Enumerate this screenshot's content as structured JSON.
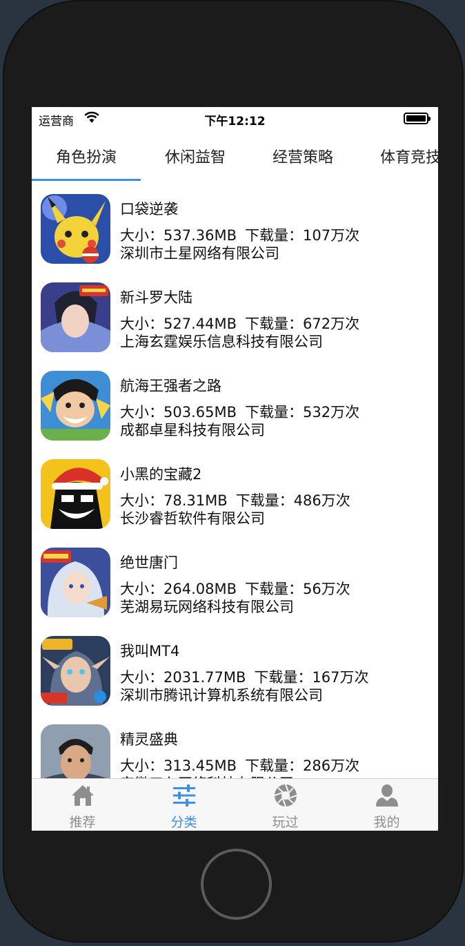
{
  "status_bar": {
    "carrier": "运营商",
    "time": "下午12:12"
  },
  "category_tabs": [
    {
      "label": "角色扮演",
      "selected": true
    },
    {
      "label": "休闲益智",
      "selected": false
    },
    {
      "label": "经营策略",
      "selected": false
    },
    {
      "label": "体育竞技",
      "selected": false
    }
  ],
  "apps": [
    {
      "name": "口袋逆袭",
      "size": "大小：537.36MB",
      "downloads": "下载量：107万次",
      "company": "深圳市土星网络有限公司",
      "icon": "pikachu-game-icon",
      "icon_color": "#2b4ea8"
    },
    {
      "name": "新斗罗大陆",
      "size": "大小：527.44MB",
      "downloads": "下载量：672万次",
      "company": "上海玄霆娱乐信息科技有限公司",
      "icon": "anime-hero-game-icon",
      "icon_color": "#3a3f8c"
    },
    {
      "name": "航海王强者之路",
      "size": "大小：503.65MB",
      "downloads": "下载量：532万次",
      "company": "成都卓星科技有限公司",
      "icon": "pirate-game-icon",
      "icon_color": "#3e8ed6"
    },
    {
      "name": "小黑的宝藏2",
      "size": "大小：78.31MB",
      "downloads": "下载量：486万次",
      "company": "长沙睿哲软件有限公司",
      "icon": "black-santa-game-icon",
      "icon_color": "#f3c21b"
    },
    {
      "name": "绝世唐门",
      "size": "大小：264.08MB",
      "downloads": "下载量：56万次",
      "company": "芜湖易玩网络科技有限公司",
      "icon": "anime-girl-game-icon",
      "icon_color": "#3b4f9c"
    },
    {
      "name": "我叫MT4",
      "size": "大小：2031.77MB",
      "downloads": "下载量：167万次",
      "company": "深圳市腾讯计算机系统有限公司",
      "icon": "elf-game-icon",
      "icon_color": "#2b3e5e"
    },
    {
      "name": "精灵盛典",
      "size": "大小：313.45MB",
      "downloads": "下载量：286万次",
      "company": "安徽三七网络科技有限公司",
      "icon": "actor-game-icon",
      "icon_color": "#8f9fb0"
    }
  ],
  "tabbar": [
    {
      "label": "推荐",
      "icon": "home-icon",
      "active": false
    },
    {
      "label": "分类",
      "icon": "sliders-icon",
      "active": true
    },
    {
      "label": "玩过",
      "icon": "aperture-icon",
      "active": false
    },
    {
      "label": "我的",
      "icon": "user-icon",
      "active": false
    }
  ],
  "colors": {
    "accent": "#3d8fe6",
    "inactive": "#8e8e8e"
  }
}
